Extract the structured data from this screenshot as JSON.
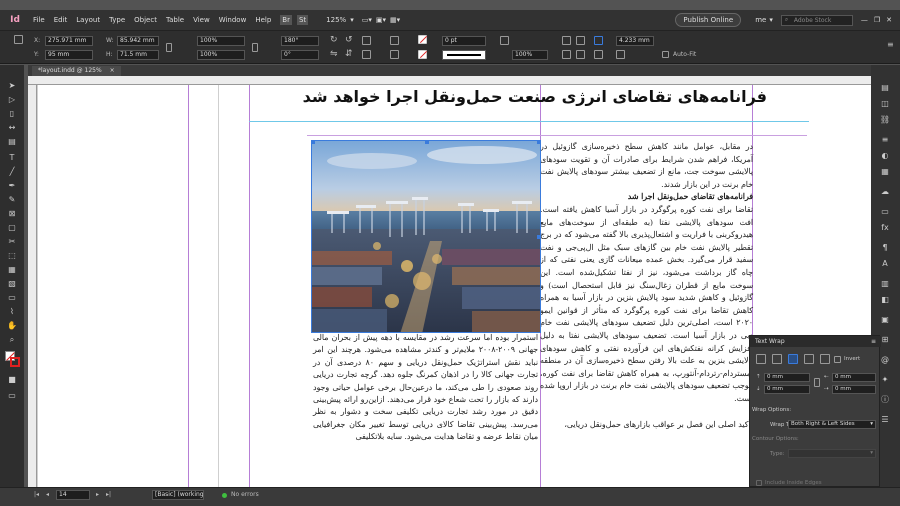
{
  "app": {
    "logo": "Id",
    "menu": [
      "File",
      "Edit",
      "Layout",
      "Type",
      "Object",
      "Table",
      "View",
      "Window",
      "Help"
    ],
    "br_label": "Br",
    "st_label": "St",
    "zoom": "125%",
    "publish_label": "Publish Online",
    "workspace": "me",
    "search_placeholder": "Adobe Stock"
  },
  "control": {
    "x_label": "X:",
    "x_value": "275.971 mm",
    "y_label": "Y:",
    "y_value": "95 mm",
    "w_label": "W:",
    "w_value": "85.942 mm",
    "h_label": "H:",
    "h_value": "71.5 mm",
    "scale_x": "100%",
    "scale_y": "100%",
    "rotate": "180°",
    "shear": "0°",
    "stroke_weight": "0 pt",
    "opacity": "100%",
    "gap": "4.233 mm",
    "autofit": "Auto-Fit"
  },
  "document": {
    "tab_label": "*layout.indd @ 125%"
  },
  "article": {
    "headline": "فرانامه‌های تقاضای انرژی صنعت حمل‌ونقل اجرا خواهد شد",
    "right_para1": "در مقابل، عوامل مانند کاهش سطح ذخیره‌سازی گازوئیل در آمریکا، فراهم شدن شرایط برای صادرات آن و تقویت سودهای پالایشی سوخت جت، مانع از تضعیف بیشتر سودهای پالایش نفت خام برنت در این بازار شدند.",
    "right_sub": "فرانامه‌های تقاضای حمل‌ونقل اجرا شد",
    "right_para2": "تقاضا برای نفت کوره پرگوگرد در بازار آسیا کاهش یافته است. افت سودهای پالایشی نفتا (به طبقه‌ای از سوخت‌های مایع هیدروکربنی با فراریت و اشتعال‌پذیری بالا گفته می‌شود که در برج تقطیر پالایش نفت خام بین گازهای سبک مثل ال‌پی‌جی و نفت سفید قرار می‌گیرد. بخش عمده میعانات گازی یعنی نفتی که از چاه گاز برداشت می‌شود، نیز از نفتا تشکیل‌شده است. این سوخت مایع از قطران زغال‌سنگ نیز قابل استحصال است) و گازوئیل و کاهش شدید سود پالایش بنزین در بازار آسیا به همراه کاهش تقاضا برای نفت کوره پرگوگرد که متأثر از قوانین ایمو ۲۰۲۰ است، اصلی‌ترین دلیل تضعیف سودهای پالایشی نفت خام دبی در بازار آسیا است. تضعیف سودهای پالایشی نفتا به دلیل افزایش کرانه نفتکش‌های این فرآورده نفتی و کاهش سودهای پالایشی بنزین به علت بالا رفتن سطح ذخیره‌سازی آن در منطقه آمستردام-رتردام-آنتورپ، به همراه کاهش تقاضا برای نفت کوره، موجب تضعیف سودهای پالایشی نفت خام برنت در بازار اروپا شده است.",
    "right_para3": "تأکید اصلی این فصل بر عواقب بازارهای حمل‌ونقل دریایی،",
    "left_text": "استمرار بوده اما سرعت رشد در مقایسه با دهه پیش از بحران مالی جهانی ۲۰۰۹-۲۰۰۸ ملایم‌تر و کندتر مشاهده می‌شود. هرچند این امر نباید نقش استراتژیک حمل‌ونقل دریایی و سهم ۸۰ درصدی آن در تجارت جهانی کالا را در اذهان کمرنگ جلوه دهد. گرچه تجارت دریایی روند صعودی را طی می‌کند، ما درعین‌حال برخی عوامل حیاتی وجود دارند که بازار را تحت شعاع خود قرار می‌دهند. ازاین‌رو ارائه پیش‌بینی دقیق در مورد رشد تجارت دریایی تکلیفی سخت و دشوار به نظر می‌رسد. پیش‌بینی تقاضا کالای دریایی توسط تغییر مکان جغرافیایی میان نقاط عرضه و تقاضا هدایت می‌شود. سایه بلاتکلیفی"
  },
  "textwrap": {
    "title": "Text Wrap",
    "invert_label": "Invert",
    "top_offset": "0 mm",
    "bottom_offset": "0 mm",
    "left_offset": "0 mm",
    "right_offset": "0 mm",
    "wrap_options_label": "Wrap Options:",
    "wrap_to_label": "Wrap To:",
    "wrap_to_value": "Both Right & Left Sides",
    "contour_label": "Contour Options:",
    "type_label": "Type:",
    "include_label": "Include Inside Edges"
  },
  "status": {
    "page": "14",
    "master": "[Basic] (working)",
    "preflight": "No errors"
  },
  "colors": {
    "ui_dark": "#323232",
    "accent_selection": "#3a7bdc",
    "guide_margin": "#b67ed6",
    "guide_column": "#6fc8e8"
  }
}
